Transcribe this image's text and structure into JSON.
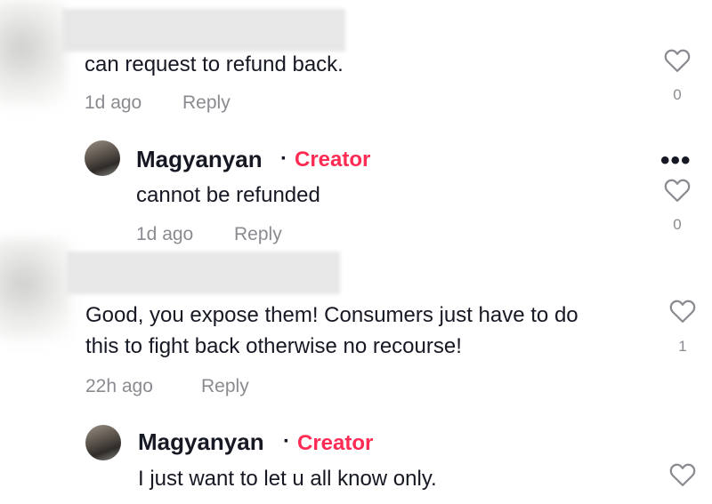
{
  "comments": [
    {
      "text_lines": [
        "can request to refund back."
      ],
      "time": "1d ago",
      "reply_label": "Reply",
      "likes": "0"
    },
    {
      "author": "Magyanyan",
      "separator": "·",
      "badge": "Creator",
      "text_lines": [
        "cannot be refunded"
      ],
      "time": "1d ago",
      "reply_label": "Reply",
      "likes": "0",
      "more_label": "•••"
    },
    {
      "text_lines": [
        "Good, you expose them! Consumers just have to do",
        "this to fight back otherwise no recourse!"
      ],
      "time": "22h ago",
      "reply_label": "Reply",
      "likes": "1"
    },
    {
      "author": "Magyanyan",
      "separator": "·",
      "badge": "Creator",
      "text_lines": [
        "I just want to let u all know only."
      ]
    }
  ],
  "colors": {
    "creator_badge": "#fe2c55",
    "secondary_text": "#8a8b91",
    "primary_text": "#161823"
  },
  "icons": {
    "like": "heart-outline-icon",
    "more": "more-dots-icon"
  }
}
